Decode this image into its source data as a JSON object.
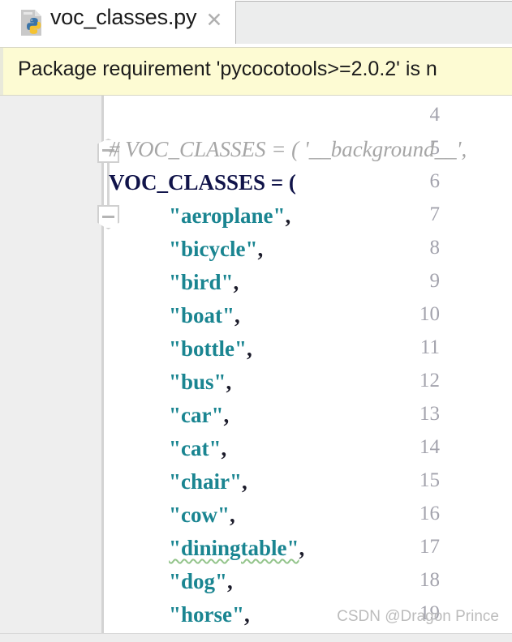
{
  "tab": {
    "filename": "voc_classes.py",
    "icon": "python-file-icon",
    "close_label": "✕"
  },
  "notification": {
    "text": "Package requirement 'pycocotools>=2.0.2' is n",
    "background": "#fdfbd3"
  },
  "editor": {
    "first_visible_line": 4,
    "gutter_background": "#eeeeee",
    "string_color": "#1a8591",
    "comment_color": "#a6a6a6",
    "lines": [
      {
        "num": "4",
        "indent": 0,
        "segments": []
      },
      {
        "num": "5",
        "indent": 0,
        "fold": "up",
        "segments": [
          {
            "t": "comment",
            "v": "# VOC_CLASSES = ( '__background__',"
          }
        ]
      },
      {
        "num": "6",
        "indent": 0,
        "segments": [
          {
            "t": "ident",
            "v": "VOC_CLASSES = ("
          }
        ]
      },
      {
        "num": "7",
        "indent": 1,
        "fold": "down",
        "segments": [
          {
            "t": "string",
            "v": "\"aeroplane\""
          },
          {
            "t": "punct",
            "v": ","
          }
        ]
      },
      {
        "num": "8",
        "indent": 1,
        "segments": [
          {
            "t": "string",
            "v": "\"bicycle\""
          },
          {
            "t": "punct",
            "v": ","
          }
        ]
      },
      {
        "num": "9",
        "indent": 1,
        "segments": [
          {
            "t": "string",
            "v": "\"bird\""
          },
          {
            "t": "punct",
            "v": ","
          }
        ]
      },
      {
        "num": "10",
        "indent": 1,
        "segments": [
          {
            "t": "string",
            "v": "\"boat\""
          },
          {
            "t": "punct",
            "v": ","
          }
        ]
      },
      {
        "num": "11",
        "indent": 1,
        "segments": [
          {
            "t": "string",
            "v": "\"bottle\""
          },
          {
            "t": "punct",
            "v": ","
          }
        ]
      },
      {
        "num": "12",
        "indent": 1,
        "segments": [
          {
            "t": "string",
            "v": "\"bus\""
          },
          {
            "t": "punct",
            "v": ","
          }
        ]
      },
      {
        "num": "13",
        "indent": 1,
        "segments": [
          {
            "t": "string",
            "v": "\"car\""
          },
          {
            "t": "punct",
            "v": ","
          }
        ]
      },
      {
        "num": "14",
        "indent": 1,
        "segments": [
          {
            "t": "string",
            "v": "\"cat\""
          },
          {
            "t": "punct",
            "v": ","
          }
        ]
      },
      {
        "num": "15",
        "indent": 1,
        "segments": [
          {
            "t": "string",
            "v": "\"chair\""
          },
          {
            "t": "punct",
            "v": ","
          }
        ]
      },
      {
        "num": "16",
        "indent": 1,
        "segments": [
          {
            "t": "string",
            "v": "\"cow\""
          },
          {
            "t": "punct",
            "v": ","
          }
        ]
      },
      {
        "num": "17",
        "indent": 1,
        "segments": [
          {
            "t": "string",
            "v": "\"diningtable\"",
            "squiggle": true
          },
          {
            "t": "punct",
            "v": ","
          }
        ]
      },
      {
        "num": "18",
        "indent": 1,
        "segments": [
          {
            "t": "string",
            "v": "\"dog\""
          },
          {
            "t": "punct",
            "v": ","
          }
        ]
      },
      {
        "num": "19",
        "indent": 1,
        "segments": [
          {
            "t": "string",
            "v": "\"horse\""
          },
          {
            "t": "punct",
            "v": ","
          }
        ]
      }
    ]
  },
  "watermark": {
    "text": "CSDN @Dragon Prince"
  }
}
